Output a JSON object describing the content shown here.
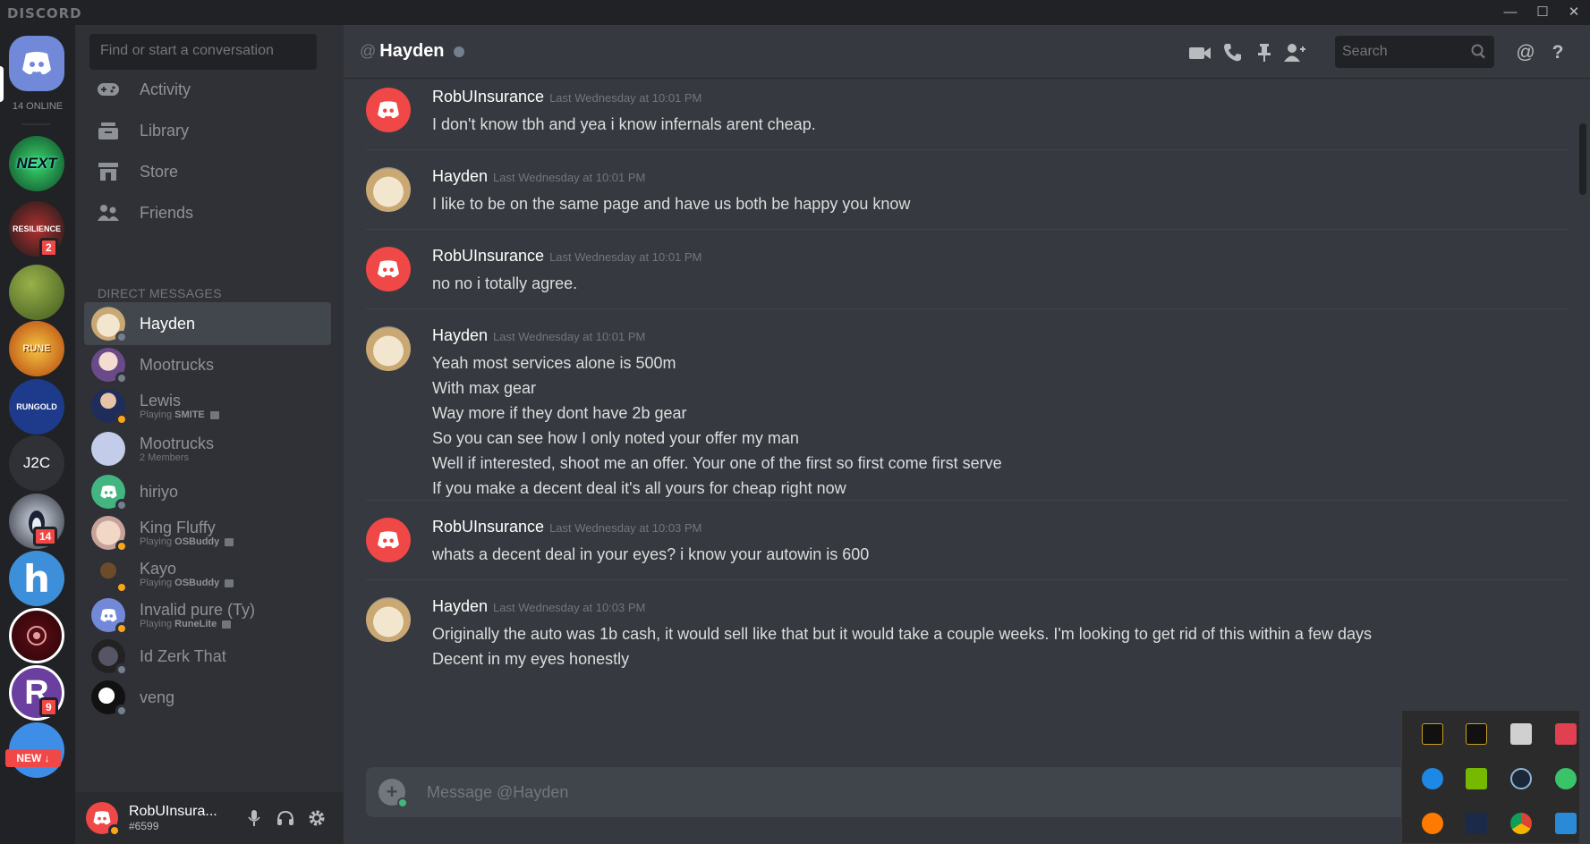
{
  "app": {
    "logo": "DISCORD",
    "window_controls": [
      "—",
      "☐",
      "✕"
    ]
  },
  "guilds": {
    "online": "14 ONLINE",
    "text_server": "J2C",
    "badges": {
      "resilience": "2",
      "penguin": "14",
      "r": "9"
    },
    "new_label": "NEW ↓"
  },
  "dm_sidebar": {
    "search_placeholder": "Find or start a conversation",
    "nav": [
      {
        "label": "Activity"
      },
      {
        "label": "Library"
      },
      {
        "label": "Store"
      },
      {
        "label": "Friends"
      }
    ],
    "section_header": "DIRECT MESSAGES",
    "dms": [
      {
        "name": "Hayden",
        "sub": "",
        "game": "",
        "status_color": "#747f8d",
        "avatar": "dog"
      },
      {
        "name": "Mootrucks",
        "sub": "",
        "game": "",
        "status_color": "#747f8d",
        "avatar": "anime"
      },
      {
        "name": "Lewis",
        "sub": "Playing",
        "game": "SMITE",
        "status_color": "#faa61a",
        "avatar": "man"
      },
      {
        "name": "Mootrucks",
        "sub": "2 Members",
        "game": "",
        "status_color": "",
        "avatar": "group"
      },
      {
        "name": "hiriyo",
        "sub": "",
        "game": "",
        "status_color": "#747f8d",
        "avatar": "discord-green"
      },
      {
        "name": "King Fluffy",
        "sub": "Playing",
        "game": "OSBuddy",
        "status_color": "#faa61a",
        "avatar": "cartoon"
      },
      {
        "name": "Kayo",
        "sub": "Playing",
        "game": "OSBuddy",
        "status_color": "#faa61a",
        "avatar": "figure"
      },
      {
        "name": "Invalid pure (Ty)",
        "sub": "Playing",
        "game": "RuneLite",
        "status_color": "#faa61a",
        "avatar": "discord-blurple"
      },
      {
        "name": "Id Zerk That",
        "sub": "",
        "game": "",
        "status_color": "#747f8d",
        "avatar": "dark"
      },
      {
        "name": "veng",
        "sub": "",
        "game": "",
        "status_color": "#747f8d",
        "avatar": "bw"
      }
    ]
  },
  "user_panel": {
    "name": "RobUInsura...",
    "tag": "#6599"
  },
  "chat": {
    "at": "@",
    "recipient": "Hayden",
    "search_placeholder": "Search",
    "messages": [
      {
        "author": "RobUInsurance",
        "time": "Last Wednesday at 10:01 PM",
        "avatar": "discord-red",
        "lines": [
          "I don't know tbh and yea i know infernals arent cheap."
        ]
      },
      {
        "author": "Hayden",
        "time": "Last Wednesday at 10:01 PM",
        "avatar": "dog",
        "lines": [
          "I like to be on the same page and have us both be happy you know"
        ]
      },
      {
        "author": "RobUInsurance",
        "time": "Last Wednesday at 10:01 PM",
        "avatar": "discord-red",
        "lines": [
          "no no i totally agree."
        ]
      },
      {
        "author": "Hayden",
        "time": "Last Wednesday at 10:01 PM",
        "avatar": "dog",
        "lines": [
          "Yeah most services alone is 500m",
          "With max gear",
          "Way more if they dont have 2b gear",
          "So you can see how I only noted your offer my man",
          "Well if interested, shoot me an offer. Your one of the first so first come first serve",
          "If you make a decent deal it's all yours for cheap right now"
        ]
      },
      {
        "author": "RobUInsurance",
        "time": "Last Wednesday at 10:03 PM",
        "avatar": "discord-red",
        "lines": [
          "whats a decent deal in your eyes? i know your autowin is 600"
        ]
      },
      {
        "author": "Hayden",
        "time": "Last Wednesday at 10:03 PM",
        "avatar": "dog",
        "lines": [
          "Originally the auto was 1b cash, it would sell like that but it would take a couple weeks. I'm looking to get rid of this within a few days",
          "Decent in my eyes honestly"
        ]
      }
    ],
    "composer_placeholder": "Message @Hayden"
  },
  "colors": {
    "blurple": "#7289da",
    "red": "#f04747",
    "green": "#43b581",
    "idle": "#faa61a",
    "offline": "#747f8d"
  }
}
